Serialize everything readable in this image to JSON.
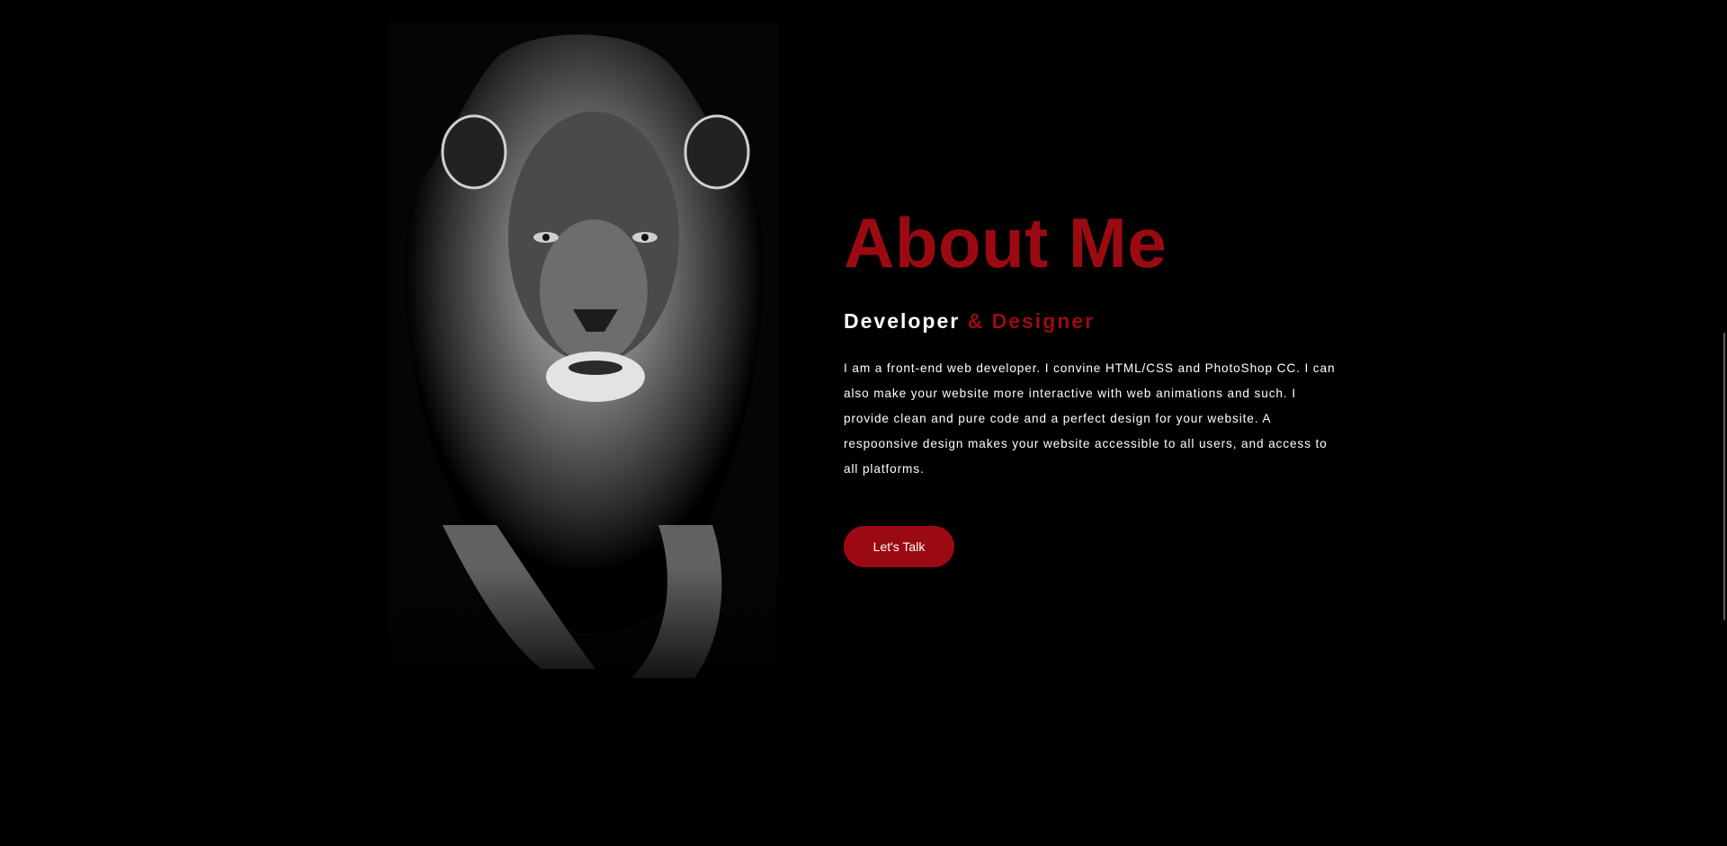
{
  "about": {
    "title": "About Me",
    "subtitle_main": "Developer",
    "subtitle_accent": " & Designer",
    "description": "I am a front-end web developer. I convine HTML/CSS and PhotoShop CC. I can also make your website more interactive with web animations and such. I provide clean and pure code and a perfect design for your website. A respoonsive design makes your website accessible to all users, and access to all platforms.",
    "cta_label": "Let's Talk"
  },
  "image": {
    "subject": "lion-portrait",
    "style": "black-and-white"
  },
  "colors": {
    "background": "#000000",
    "accent": "#9b0a12",
    "text": "#ffffff"
  }
}
